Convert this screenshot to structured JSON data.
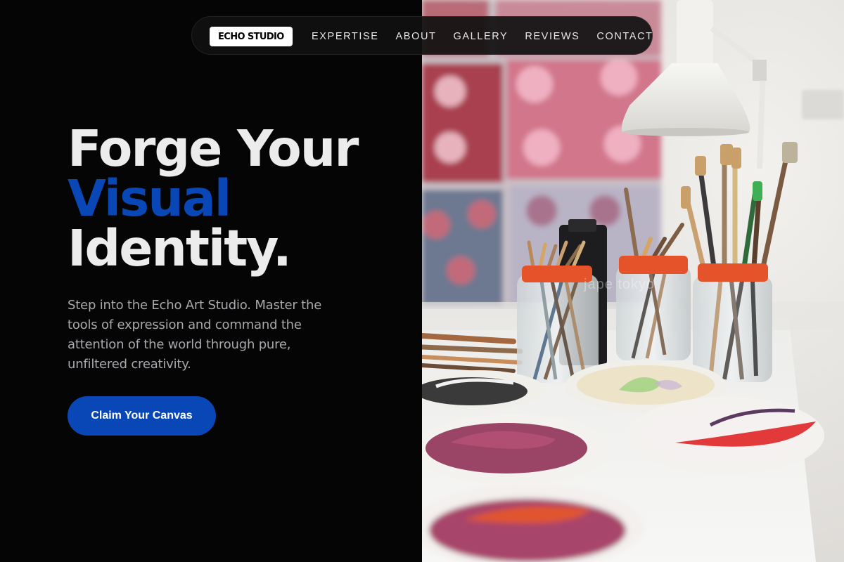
{
  "brand": {
    "logo_text": "ECHO STUDIO"
  },
  "nav": {
    "links": [
      "EXPERTISE",
      "ABOUT",
      "GALLERY",
      "REVIEWS",
      "CONTACT"
    ]
  },
  "hero": {
    "title_line1": "Forge Your",
    "title_line2": "Visual",
    "title_line3": "Identity.",
    "description": "Step into the Echo Art Studio. Master the tools of expression and command the attention of the world through pure, unfiltered creativity.",
    "cta_label": "Claim Your Canvas"
  },
  "image": {
    "watermark": "jape tokyo",
    "icon": "art-studio-photo"
  },
  "colors": {
    "accent": "#0a47b6",
    "background": "#050506",
    "text": "#ececec",
    "muted": "#a9a9ad"
  }
}
